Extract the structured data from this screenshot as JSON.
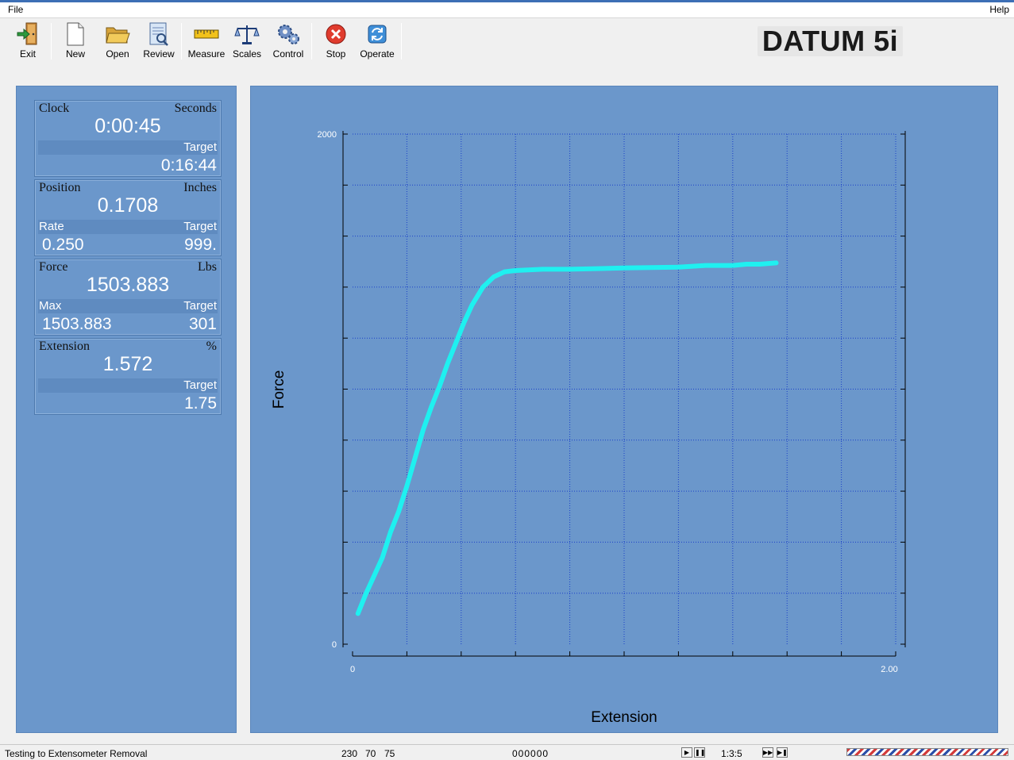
{
  "window": {
    "menu_left": "File",
    "menu_right": "Help"
  },
  "toolbar": {
    "buttons": [
      {
        "label": "Exit",
        "icon": "exit-door-icon"
      },
      {
        "label": "New",
        "icon": "new-document-icon"
      },
      {
        "label": "Open",
        "icon": "open-folder-icon"
      },
      {
        "label": "Review",
        "icon": "review-document-icon"
      },
      {
        "label": "Measure",
        "icon": "ruler-icon"
      },
      {
        "label": "Scales",
        "icon": "balance-scale-icon"
      },
      {
        "label": "Control",
        "icon": "gears-icon"
      },
      {
        "label": "Stop",
        "icon": "stop-icon"
      },
      {
        "label": "Operate",
        "icon": "refresh-arrows-icon"
      }
    ]
  },
  "brand": "DATUM 5i",
  "readouts": {
    "clock": {
      "title": "Clock",
      "unit": "Seconds",
      "value": "0:00:45",
      "sub_right_label": "Target",
      "sub_right_value": "0:16:44"
    },
    "position": {
      "title": "Position",
      "unit": "Inches",
      "value": "0.1708",
      "sub_left_label": "Rate",
      "sub_left_value": "0.250",
      "sub_right_label": "Target",
      "sub_right_value": "999."
    },
    "force": {
      "title": "Force",
      "unit": "Lbs",
      "value": "1503.883",
      "sub_left_label": "Max",
      "sub_left_value": "1503.883",
      "sub_right_label": "Target",
      "sub_right_value": "301"
    },
    "extension": {
      "title": "Extension",
      "unit": "%",
      "value": "1.572",
      "sub_right_label": "Target",
      "sub_right_value": "1.75"
    }
  },
  "chart_data": {
    "type": "line",
    "xlabel": "Extension",
    "ylabel": "Force",
    "xlim": [
      0,
      2.0
    ],
    "ylim": [
      0,
      2000
    ],
    "x_tick_labels": [
      "0",
      "2.00"
    ],
    "y_tick_labels": [
      "0",
      "2000"
    ],
    "grid": true,
    "series_color": "#1ff0f0",
    "series": [
      {
        "x": [
          0.02,
          0.05,
          0.08,
          0.11,
          0.14,
          0.17,
          0.2,
          0.23,
          0.26,
          0.29,
          0.32,
          0.35,
          0.38,
          0.41,
          0.44,
          0.48,
          0.52,
          0.56,
          0.6,
          0.7,
          0.8,
          1.0,
          1.2,
          1.3,
          1.4,
          1.45,
          1.5,
          1.56
        ],
        "y": [
          120,
          200,
          270,
          340,
          440,
          520,
          620,
          730,
          840,
          930,
          1010,
          1100,
          1180,
          1260,
          1330,
          1400,
          1440,
          1460,
          1465,
          1470,
          1470,
          1475,
          1478,
          1485,
          1485,
          1490,
          1490,
          1495
        ]
      }
    ]
  },
  "status": {
    "message": "Testing to Extensometer Removal",
    "num1": "230",
    "num2": "70",
    "num3": "75",
    "counter": "000000",
    "speed": "1:3:5"
  }
}
